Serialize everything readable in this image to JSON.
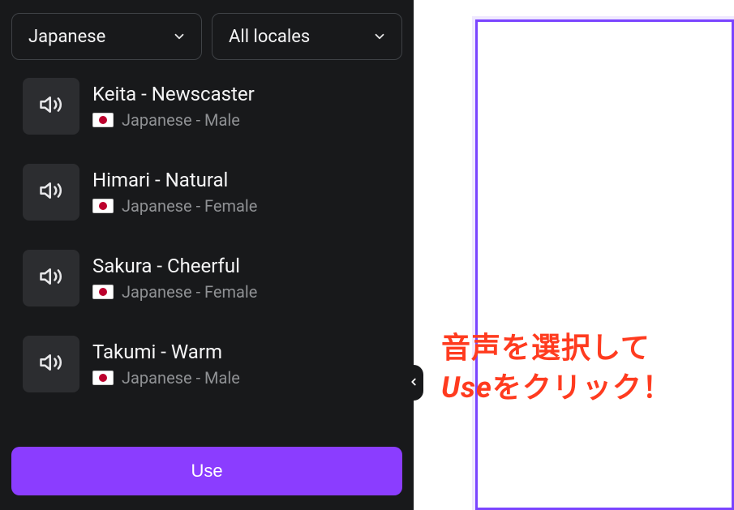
{
  "filters": {
    "language": "Japanese",
    "locale": "All locales"
  },
  "voices": [
    {
      "name": "Keita - Newscaster",
      "desc": "Japanese - Male",
      "flag": "jp"
    },
    {
      "name": "Himari - Natural",
      "desc": "Japanese - Female",
      "flag": "jp"
    },
    {
      "name": "Sakura - Cheerful",
      "desc": "Japanese - Female",
      "flag": "jp"
    },
    {
      "name": "Takumi - Warm",
      "desc": "Japanese - Male",
      "flag": "jp"
    }
  ],
  "use_button": "Use",
  "annotation": {
    "line1": "音声を選択して",
    "line2_em": "Use",
    "line2_rest": "をクリック！"
  },
  "colors": {
    "accent": "#8b3dff",
    "panel": "#18191b",
    "annotation": "#ff3b1f"
  }
}
